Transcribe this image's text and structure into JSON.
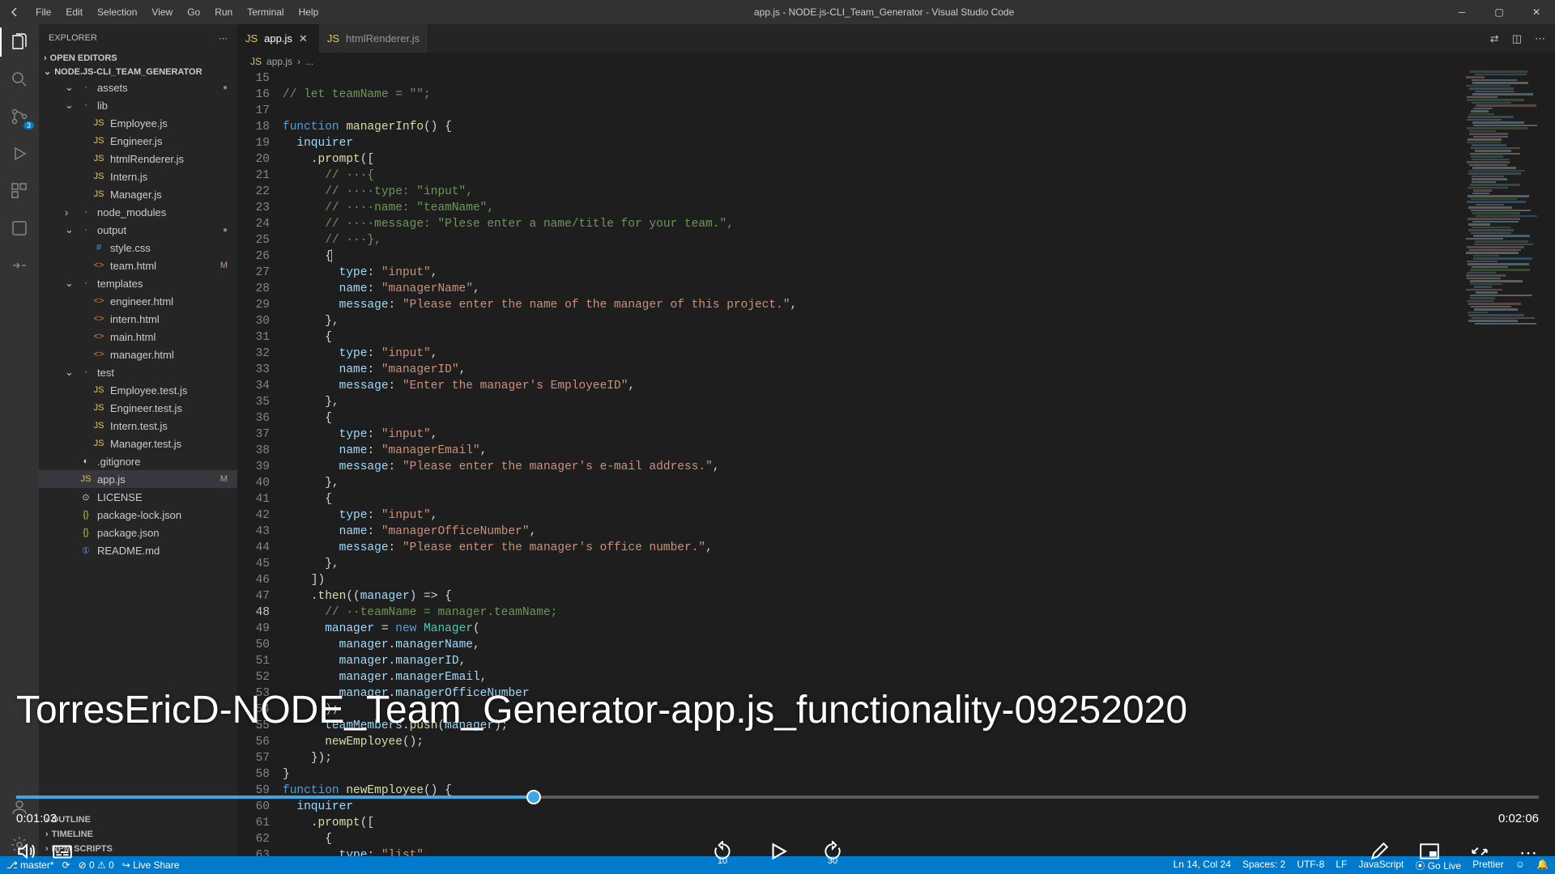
{
  "window": {
    "title": "app.js - NODE.js-CLI_Team_Generator - Visual Studio Code"
  },
  "menu": {
    "items": [
      "File",
      "Edit",
      "Selection",
      "View",
      "Go",
      "Run",
      "Terminal",
      "Help"
    ]
  },
  "explorer": {
    "header": "EXPLORER",
    "openEditors": "OPEN EDITORS",
    "project": "NODE.JS-CLI_TEAM_GENERATOR",
    "tree": [
      {
        "depth": 1,
        "kind": "folder",
        "open": true,
        "name": "assets",
        "dot": true
      },
      {
        "depth": 1,
        "kind": "folder",
        "open": true,
        "name": "lib"
      },
      {
        "depth": 2,
        "kind": "js",
        "name": "Employee.js"
      },
      {
        "depth": 2,
        "kind": "js",
        "name": "Engineer.js"
      },
      {
        "depth": 2,
        "kind": "js",
        "name": "htmlRenderer.js"
      },
      {
        "depth": 2,
        "kind": "js",
        "name": "Intern.js"
      },
      {
        "depth": 2,
        "kind": "js",
        "name": "Manager.js"
      },
      {
        "depth": 1,
        "kind": "folder",
        "open": false,
        "name": "node_modules"
      },
      {
        "depth": 1,
        "kind": "folder",
        "open": true,
        "name": "output",
        "dot": true
      },
      {
        "depth": 2,
        "kind": "css",
        "name": "style.css"
      },
      {
        "depth": 2,
        "kind": "html",
        "name": "team.html",
        "badge": "M"
      },
      {
        "depth": 1,
        "kind": "folder",
        "open": true,
        "name": "templates"
      },
      {
        "depth": 2,
        "kind": "html",
        "name": "engineer.html"
      },
      {
        "depth": 2,
        "kind": "html",
        "name": "intern.html"
      },
      {
        "depth": 2,
        "kind": "html",
        "name": "main.html"
      },
      {
        "depth": 2,
        "kind": "html",
        "name": "manager.html"
      },
      {
        "depth": 1,
        "kind": "folder",
        "open": true,
        "name": "test"
      },
      {
        "depth": 2,
        "kind": "js",
        "name": "Employee.test.js"
      },
      {
        "depth": 2,
        "kind": "js",
        "name": "Engineer.test.js"
      },
      {
        "depth": 2,
        "kind": "js",
        "name": "Intern.test.js"
      },
      {
        "depth": 2,
        "kind": "js",
        "name": "Manager.test.js"
      },
      {
        "depth": 1,
        "kind": "gitignore",
        "name": ".gitignore"
      },
      {
        "depth": 1,
        "kind": "js",
        "name": "app.js",
        "badge": "M",
        "selected": true
      },
      {
        "depth": 1,
        "kind": "license",
        "name": "LICENSE"
      },
      {
        "depth": 1,
        "kind": "json",
        "name": "package-lock.json"
      },
      {
        "depth": 1,
        "kind": "json",
        "name": "package.json"
      },
      {
        "depth": 1,
        "kind": "md",
        "name": "README.md"
      }
    ],
    "outline": "OUTLINE",
    "timeline": "TIMELINE",
    "npmScripts": "NPM SCRIPTS"
  },
  "tabs": [
    {
      "label": "app.js",
      "icon": "js",
      "active": true,
      "close": true
    },
    {
      "label": "htmlRenderer.js",
      "icon": "js",
      "active": false
    }
  ],
  "breadcrumb": {
    "file": "app.js",
    "rest": "..."
  },
  "code": {
    "startLine": 15,
    "highlightLine": 48,
    "lines": [
      {
        "t": "plain",
        "txt": ""
      },
      {
        "t": "comment",
        "txt": "// let teamName = \"\";"
      },
      {
        "t": "plain",
        "txt": ""
      },
      {
        "t": "funcdecl",
        "kw": "function",
        "name": "managerInfo",
        "rest": "() {"
      },
      {
        "t": "var",
        "indent": "··",
        "id": "inquirer"
      },
      {
        "t": "call",
        "indent": "····",
        "punc": ".",
        "fn": "prompt",
        "rest": "(["
      },
      {
        "t": "comment",
        "indent": "······",
        "txt": "// ···{"
      },
      {
        "t": "comment",
        "indent": "······",
        "txt": "// ····type: \"input\","
      },
      {
        "t": "comment",
        "indent": "······",
        "txt": "// ····name: \"teamName\","
      },
      {
        "t": "comment",
        "indent": "······",
        "txt": "// ····message: \"Plese enter a name/title for your team.\","
      },
      {
        "t": "comment",
        "indent": "······",
        "txt": "// ···},"
      },
      {
        "t": "punc",
        "indent": "······",
        "txt": "{",
        "cursor": true
      },
      {
        "t": "prop",
        "indent": "········",
        "k": "type",
        "v": "\"input\"",
        "trail": ","
      },
      {
        "t": "prop",
        "indent": "········",
        "k": "name",
        "v": "\"managerName\"",
        "trail": ","
      },
      {
        "t": "prop",
        "indent": "········",
        "k": "message",
        "v": "\"Please enter the name of the manager of this project.\"",
        "trail": ","
      },
      {
        "t": "punc",
        "indent": "······",
        "txt": "},"
      },
      {
        "t": "punc",
        "indent": "······",
        "txt": "{"
      },
      {
        "t": "prop",
        "indent": "········",
        "k": "type",
        "v": "\"input\"",
        "trail": ","
      },
      {
        "t": "prop",
        "indent": "········",
        "k": "name",
        "v": "\"managerID\"",
        "trail": ","
      },
      {
        "t": "prop",
        "indent": "········",
        "k": "message",
        "v": "\"Enter the manager's EmployeeID\"",
        "trail": ","
      },
      {
        "t": "punc",
        "indent": "······",
        "txt": "},"
      },
      {
        "t": "punc",
        "indent": "······",
        "txt": "{"
      },
      {
        "t": "prop",
        "indent": "········",
        "k": "type",
        "v": "\"input\"",
        "trail": ","
      },
      {
        "t": "prop",
        "indent": "········",
        "k": "name",
        "v": "\"managerEmail\"",
        "trail": ","
      },
      {
        "t": "prop",
        "indent": "········",
        "k": "message",
        "v": "\"Please enter the manager's e-mail address.\"",
        "trail": ","
      },
      {
        "t": "punc",
        "indent": "······",
        "txt": "},"
      },
      {
        "t": "punc",
        "indent": "······",
        "txt": "{"
      },
      {
        "t": "prop",
        "indent": "········",
        "k": "type",
        "v": "\"input\"",
        "trail": ","
      },
      {
        "t": "prop",
        "indent": "········",
        "k": "name",
        "v": "\"managerOfficeNumber\"",
        "trail": ","
      },
      {
        "t": "prop",
        "indent": "········",
        "k": "message",
        "v": "\"Please enter the manager's office number.\"",
        "trail": ","
      },
      {
        "t": "punc",
        "indent": "······",
        "txt": "},"
      },
      {
        "t": "punc",
        "indent": "····",
        "txt": "])"
      },
      {
        "t": "then",
        "indent": "····",
        "punc": ".",
        "fn": "then",
        "rest": "((",
        "param": "manager",
        "rest2": ") => {"
      },
      {
        "t": "comment",
        "indent": "······",
        "txt": "// ··teamName = manager.teamName;"
      },
      {
        "t": "assign",
        "indent": "······",
        "id": "manager",
        "eq": " = ",
        "new": "new ",
        "cls": "Manager",
        "rest": "("
      },
      {
        "t": "dot",
        "indent": "········",
        "obj": "manager",
        "prop": "managerName",
        "trail": ","
      },
      {
        "t": "dot",
        "indent": "········",
        "obj": "manager",
        "prop": "managerID",
        "trail": ","
      },
      {
        "t": "dot",
        "indent": "········",
        "obj": "manager",
        "prop": "managerEmail",
        "trail": ","
      },
      {
        "t": "dot",
        "indent": "········",
        "obj": "manager",
        "prop": "managerOfficeNumber",
        "trail": ""
      },
      {
        "t": "punc",
        "indent": "······",
        "txt": ");"
      },
      {
        "t": "push",
        "indent": "······",
        "obj": "teamMembers",
        "fn": "push",
        "arg": "manager",
        "rest": ");"
      },
      {
        "t": "callsimple",
        "indent": "······",
        "fn": "newEmployee",
        "rest": "();"
      },
      {
        "t": "punc",
        "indent": "····",
        "txt": "});"
      },
      {
        "t": "punc",
        "indent": "",
        "txt": "}"
      },
      {
        "t": "funcdecl",
        "kw": "function",
        "name": "newEmployee",
        "rest": "() {"
      },
      {
        "t": "var",
        "indent": "··",
        "id": "inquirer"
      },
      {
        "t": "call",
        "indent": "····",
        "punc": ".",
        "fn": "prompt",
        "rest": "(["
      },
      {
        "t": "punc",
        "indent": "······",
        "txt": "{"
      },
      {
        "t": "prop",
        "indent": "········",
        "k": "type",
        "v": "\"list\"",
        "trail": ","
      }
    ]
  },
  "statusBar": {
    "branch": "master*",
    "sync": "",
    "problems": "⊘ 0  ⚠ 0",
    "liveShare": "Live Share",
    "lineCol": "Ln 14, Col 24",
    "spaces": "Spaces: 2",
    "encoding": "UTF-8",
    "eol": "LF",
    "lang": "JavaScript",
    "goLive": "⦿ Go Live",
    "prettier": "Prettier",
    "bell": "🔔"
  },
  "video": {
    "title": "TorresEricD-NODE_Team_Generator-app.js_functionality-09252020",
    "current": "0:01:03",
    "total": "0:02:06",
    "skipBack": "10",
    "skipFwd": "30",
    "progressPct": 34.0
  },
  "colors": {
    "accent": "#007acc",
    "videoAccent": "#3ba7e5"
  }
}
